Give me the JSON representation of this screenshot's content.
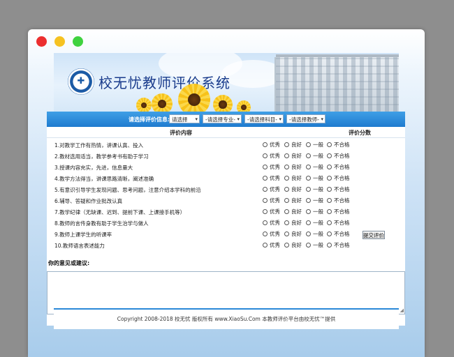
{
  "site": {
    "title": "校无忧教师评价系统"
  },
  "filter": {
    "label": "请选择评价信息:",
    "selects": [
      "请选择",
      "-请选择专业-",
      "-请选择科目-",
      "-请选择教师-"
    ]
  },
  "table": {
    "headers": {
      "content": "评价内容",
      "score": "评价分数"
    },
    "options": [
      "优秀",
      "良好",
      "一般",
      "不合格"
    ],
    "questions": [
      "1.对教学工作有热情，讲课认真、投入",
      "2.教材选用适当，教学参考书有助于学习",
      "3.授课内容充实，先进，信息量大",
      "4.教学方法得当，讲课思路清晰，阐述准确",
      "5.有意识引导学生发现问题、思考问题，注意介绍本学科的前沿",
      "6.辅导、答疑和作业批改认真",
      "7.教学纪律（无缺课、迟到、提前下课、上课接手机等）",
      "8.教师的言传身教有助于学生治学与做人",
      "9.教师上课学生的听课率",
      "10.教师语言表述能力"
    ]
  },
  "suggest": {
    "label": "你的意见或建议:"
  },
  "submit": {
    "label": "提交评价"
  },
  "footer": {
    "text": "Copyright 2008-2018 校无忧 版权所有 www.XiaoSu.Com 本教师评价平台由校无忧™提供"
  }
}
